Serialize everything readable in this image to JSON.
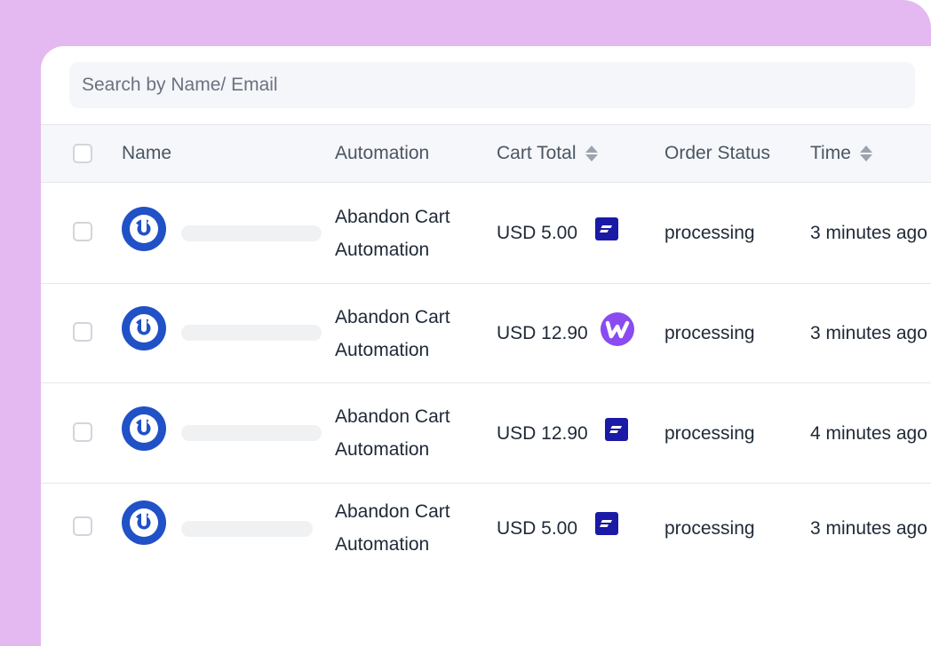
{
  "search": {
    "placeholder": "Search by Name/ Email"
  },
  "table": {
    "headers": {
      "name": "Name",
      "automation": "Automation",
      "cart_total": "Cart Total",
      "order_status": "Order Status",
      "time": "Time"
    },
    "rows": [
      {
        "automation_line1": "Abandon Cart",
        "automation_line2": "Automation",
        "cart_total": "USD 5.00",
        "source_icon": "fluentcart-icon",
        "order_status": "processing",
        "time": "3 minutes ago"
      },
      {
        "automation_line1": "Abandon Cart",
        "automation_line2": "Automation",
        "cart_total": "USD 12.90",
        "source_icon": "woocommerce-icon",
        "order_status": "processing",
        "time": "3 minutes ago"
      },
      {
        "automation_line1": "Abandon Cart",
        "automation_line2": "Automation",
        "cart_total": "USD 12.90",
        "source_icon": "fluentcart-icon",
        "order_status": "processing",
        "time": "4 minutes ago"
      },
      {
        "automation_line1": "Abandon Cart",
        "automation_line2": "Automation",
        "cart_total": "USD 5.00",
        "source_icon": "fluentcart-icon",
        "order_status": "processing",
        "time": "3 minutes ago"
      }
    ]
  },
  "colors": {
    "frame": "#e4b8f0",
    "avatar": "#2151c7",
    "fluentcart": "#1a1aa6",
    "woocommerce": "#8a4bf0"
  }
}
